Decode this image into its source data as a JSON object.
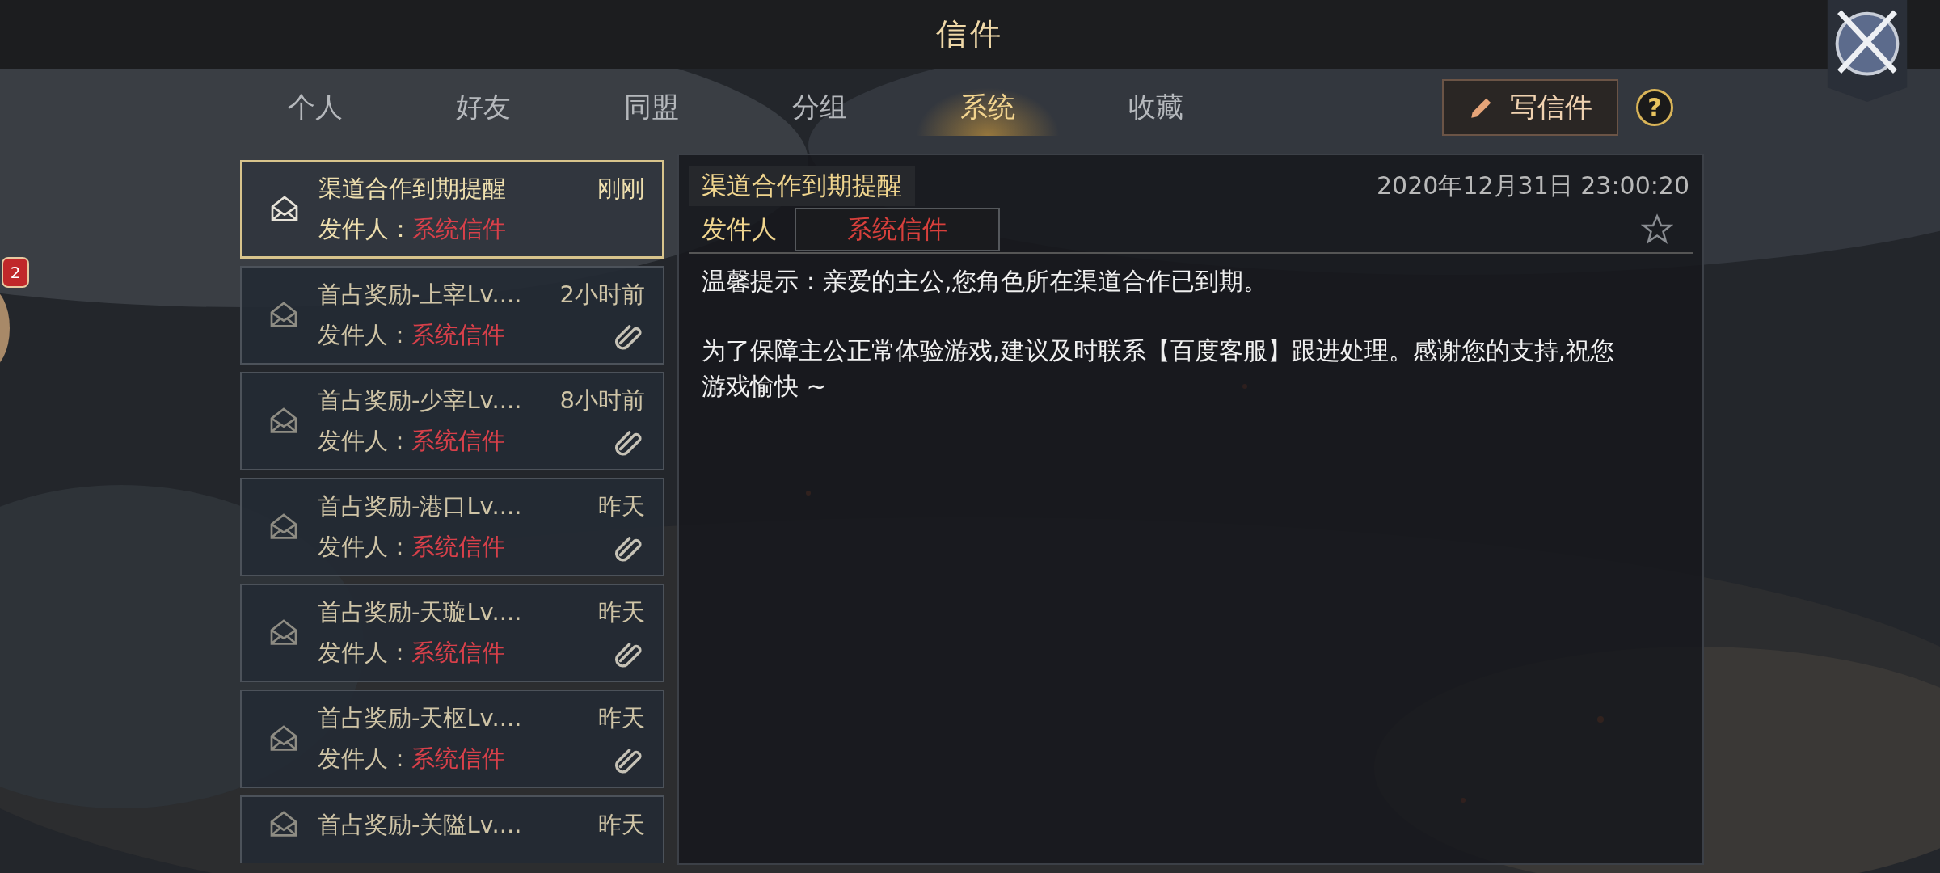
{
  "window": {
    "title": "信件"
  },
  "tabs": [
    {
      "label": "个人",
      "selected": false
    },
    {
      "label": "好友",
      "selected": false
    },
    {
      "label": "同盟",
      "selected": false
    },
    {
      "label": "分组",
      "selected": false
    },
    {
      "label": "系统",
      "selected": true
    },
    {
      "label": "收藏",
      "selected": false
    }
  ],
  "compose_button": {
    "label": "写信件"
  },
  "help_button": {
    "label": "?"
  },
  "side_badge": {
    "count": "2"
  },
  "mails": [
    {
      "title": "渠道合作到期提醒",
      "time": "刚刚",
      "sender_label": "发件人：",
      "sender": "系统信件",
      "attachment": false,
      "selected": true
    },
    {
      "title": "首占奖励-上宰Lv....",
      "time": "2小时前",
      "sender_label": "发件人：",
      "sender": "系统信件",
      "attachment": true,
      "selected": false
    },
    {
      "title": "首占奖励-少宰Lv....",
      "time": "8小时前",
      "sender_label": "发件人：",
      "sender": "系统信件",
      "attachment": true,
      "selected": false
    },
    {
      "title": "首占奖励-港口Lv....",
      "time": "昨天",
      "sender_label": "发件人：",
      "sender": "系统信件",
      "attachment": true,
      "selected": false
    },
    {
      "title": "首占奖励-天璇Lv....",
      "time": "昨天",
      "sender_label": "发件人：",
      "sender": "系统信件",
      "attachment": true,
      "selected": false
    },
    {
      "title": "首占奖励-天枢Lv....",
      "time": "昨天",
      "sender_label": "发件人：",
      "sender": "系统信件",
      "attachment": true,
      "selected": false
    },
    {
      "title": "首占奖励-关隘Lv....",
      "time": "昨天",
      "selected": false
    }
  ],
  "detail": {
    "title": "渠道合作到期提醒",
    "date": "2020年12月31日 23:00:20",
    "sender_label": "发件人",
    "sender": "系统信件",
    "starred": false,
    "body": [
      "温馨提示：亲爱的主公,您角色所在渠道合作已到期。",
      "为了保障主公正常体验游戏,建议及时联系【百度客服】跟进处理。感谢您的支持,祝您游戏愉快 ~"
    ]
  }
}
